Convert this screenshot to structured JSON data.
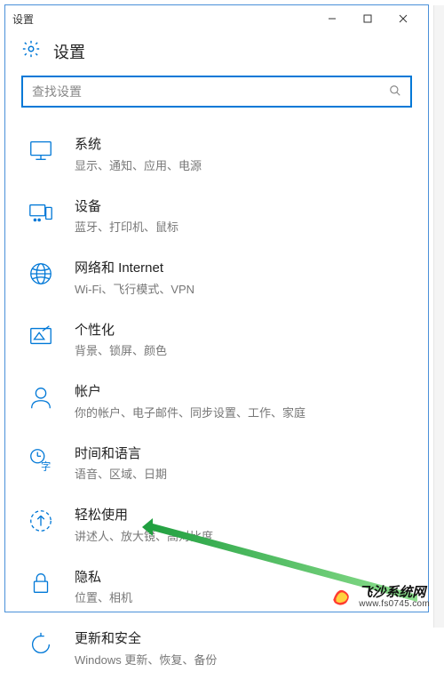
{
  "window": {
    "title": "设置",
    "app_label": "设置"
  },
  "search": {
    "placeholder": "查找设置"
  },
  "categories": [
    {
      "icon": "monitor-icon",
      "title": "系统",
      "sub": "显示、通知、应用、电源"
    },
    {
      "icon": "devices-icon",
      "title": "设备",
      "sub": "蓝牙、打印机、鼠标"
    },
    {
      "icon": "globe-icon",
      "title": "网络和 Internet",
      "sub": "Wi-Fi、飞行模式、VPN"
    },
    {
      "icon": "personalize-icon",
      "title": "个性化",
      "sub": "背景、锁屏、颜色"
    },
    {
      "icon": "person-icon",
      "title": "帐户",
      "sub": "你的帐户、电子邮件、同步设置、工作、家庭"
    },
    {
      "icon": "time-lang-icon",
      "title": "时间和语言",
      "sub": "语音、区域、日期"
    },
    {
      "icon": "ease-icon",
      "title": "轻松使用",
      "sub": "讲述人、放大镜、高对比度"
    },
    {
      "icon": "lock-icon",
      "title": "隐私",
      "sub": "位置、相机"
    },
    {
      "icon": "update-icon",
      "title": "更新和安全",
      "sub": "Windows 更新、恢复、备份"
    }
  ],
  "watermark": {
    "name": "飞沙系统网",
    "url": "www.fs0745.com"
  }
}
